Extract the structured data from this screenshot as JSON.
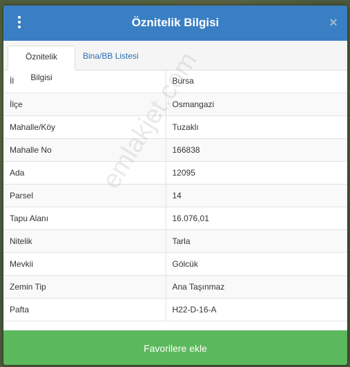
{
  "dialog": {
    "title": "Öznitelik Bilgisi",
    "close_glyph": "×"
  },
  "tabs": [
    {
      "label": "Öznitelik Bilgisi",
      "active": true
    },
    {
      "label": "Bina/BB Listesi",
      "active": false
    }
  ],
  "attributes": [
    {
      "label": "İl",
      "value": "Bursa"
    },
    {
      "label": "İlçe",
      "value": "Osmangazi"
    },
    {
      "label": "Mahalle/Köy",
      "value": "Tuzaklı"
    },
    {
      "label": "Mahalle No",
      "value": "166838"
    },
    {
      "label": "Ada",
      "value": "12095"
    },
    {
      "label": "Parsel",
      "value": "14"
    },
    {
      "label": "Tapu Alanı",
      "value": "16.076,01"
    },
    {
      "label": "Nitelik",
      "value": "Tarla"
    },
    {
      "label": "Mevkii",
      "value": "Gölcük"
    },
    {
      "label": "Zemin Tip",
      "value": "Ana Taşınmaz"
    },
    {
      "label": "Pafta",
      "value": "H22-D-16-A"
    }
  ],
  "watermark": "emlakjet.com",
  "footer": {
    "favorite_label": "Favorilere ekle"
  },
  "colors": {
    "header": "#3a7fc4",
    "button": "#5cb85c",
    "link": "#2a6db0"
  }
}
